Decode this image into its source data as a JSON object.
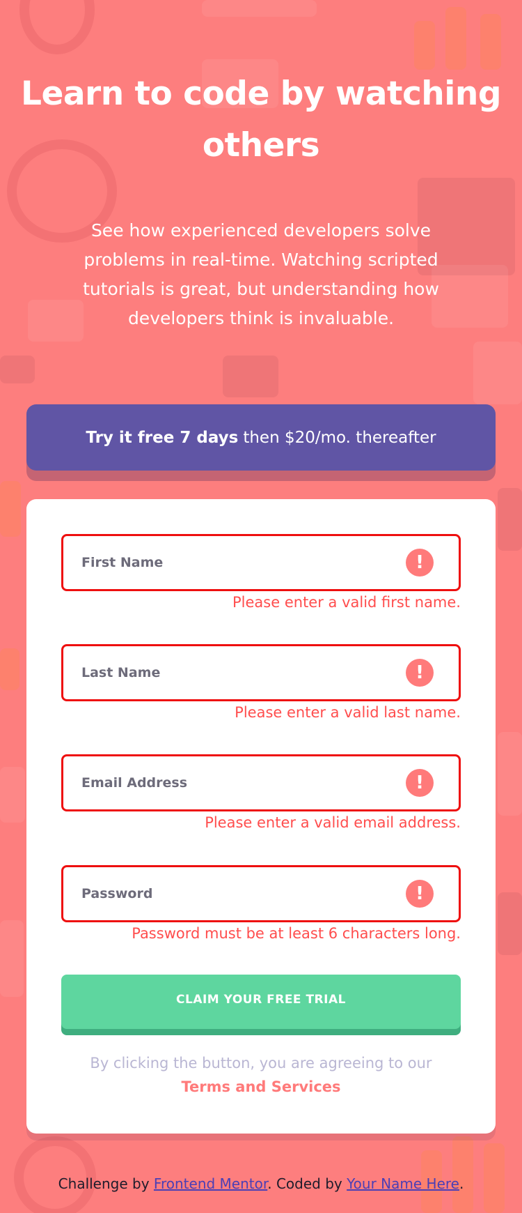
{
  "hero": {
    "title": "Learn to code by watching others",
    "description": "See how experienced developers solve problems in real-time. Watching scripted tutorials is great, but understanding how developers think is invaluable."
  },
  "promo": {
    "bold_text": "Try it free 7 days",
    "rest_text": "then $20/mo. thereafter"
  },
  "form": {
    "fields": [
      {
        "placeholder": "First Name",
        "value": "",
        "error": "Please enter a valid first name.",
        "error_icon": "exclamation-icon"
      },
      {
        "placeholder": "Last Name",
        "value": "",
        "error": "Please enter a valid last name.",
        "error_icon": "exclamation-icon"
      },
      {
        "placeholder": "Email Address",
        "value": "",
        "error": "Please enter a valid email address.",
        "error_icon": "exclamation-icon"
      },
      {
        "placeholder": "Password",
        "value": "",
        "error": "Password must be at least 6 characters long.",
        "error_icon": "exclamation-icon"
      }
    ],
    "error_icon_glyph": "!",
    "submit_label": "CLAIM YOUR FREE TRIAL",
    "terms_prefix": "By clicking the button, you are agreeing to our",
    "terms_link": "Terms and Services"
  },
  "attribution": {
    "prefix": "Challenge by",
    "link1": "Frontend Mentor",
    "middle": ". Coded by",
    "link2": "Your Name Here",
    "suffix": "."
  },
  "colors": {
    "background": "#fd7e7e",
    "promo": "#6055a5",
    "error": "#ff4d4d",
    "field_error_border": "#ee0f0f",
    "submit": "#5ed69f",
    "terms_link": "#ff7a7a"
  }
}
